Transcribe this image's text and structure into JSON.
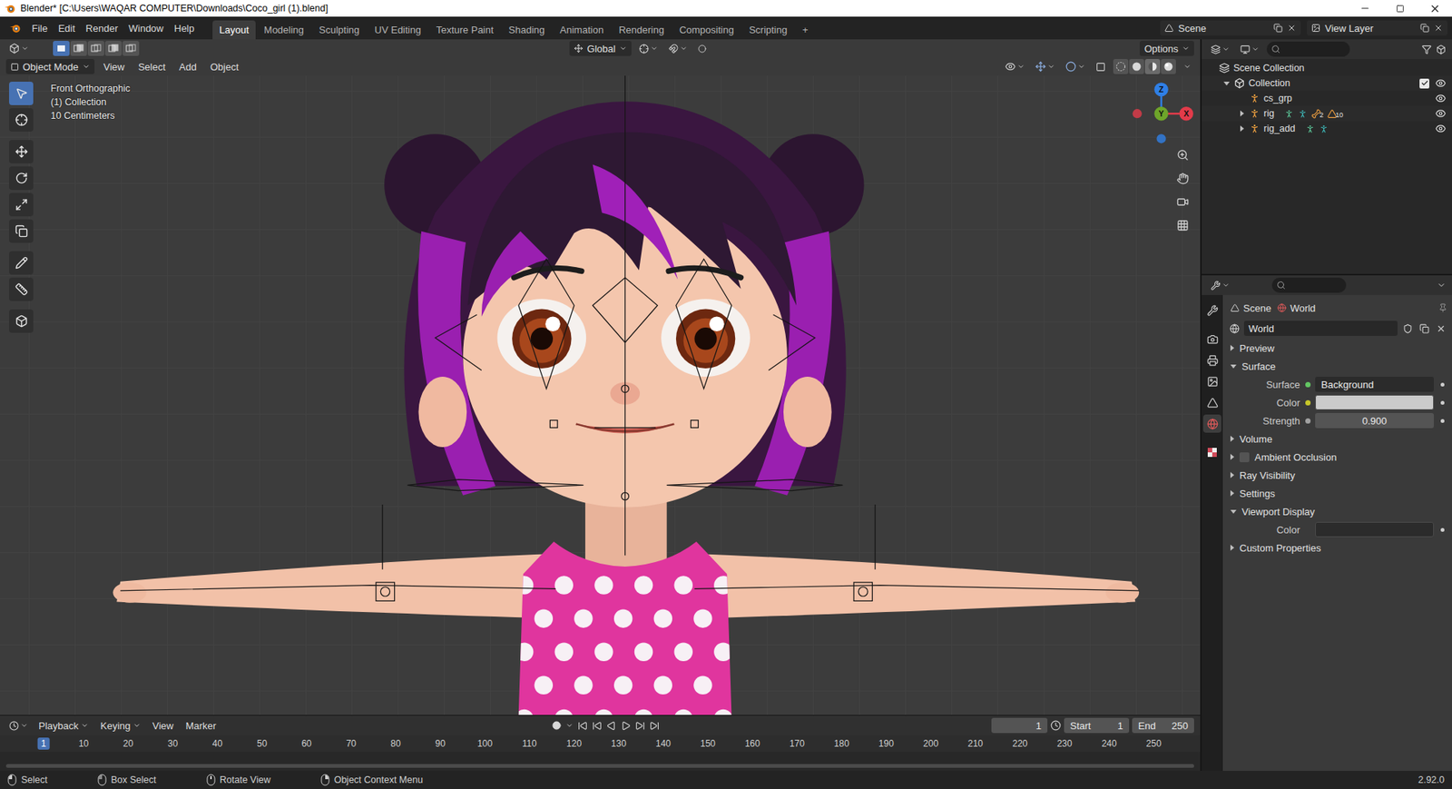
{
  "window": {
    "title": "Blender* [C:\\Users\\WAQAR COMPUTER\\Downloads\\Coco_girl (1).blend]"
  },
  "menus": [
    "File",
    "Edit",
    "Render",
    "Window",
    "Help"
  ],
  "workspaces": [
    {
      "label": "Layout",
      "selected": true
    },
    {
      "label": "Modeling",
      "selected": false
    },
    {
      "label": "Sculpting",
      "selected": false
    },
    {
      "label": "UV Editing",
      "selected": false
    },
    {
      "label": "Texture Paint",
      "selected": false
    },
    {
      "label": "Shading",
      "selected": false
    },
    {
      "label": "Animation",
      "selected": false
    },
    {
      "label": "Rendering",
      "selected": false
    },
    {
      "label": "Compositing",
      "selected": false
    },
    {
      "label": "Scripting",
      "selected": false
    }
  ],
  "add_workspace": "+",
  "scene": "Scene",
  "view_layer": "View Layer",
  "viewport": {
    "orientation": "Global",
    "options": "Options",
    "mode": "Object Mode",
    "menus": [
      "View",
      "Select",
      "Add",
      "Object"
    ],
    "info": [
      "Front Orthographic",
      "(1) Collection",
      "10 Centimeters"
    ],
    "select_modes": [
      {
        "selected": true
      },
      {
        "selected": false
      },
      {
        "selected": false
      },
      {
        "selected": false
      },
      {
        "selected": false
      }
    ],
    "tools": [
      {
        "selected": true
      },
      {
        "selected": false
      },
      {
        "selected": false
      },
      {
        "selected": false
      },
      {
        "selected": false
      },
      {
        "selected": false
      },
      {
        "selected": false
      },
      {
        "selected": false
      },
      {
        "selected": false
      }
    ],
    "gizmo": [
      {
        "label": "Z",
        "color": "#2f7fe6"
      },
      {
        "label": "Y",
        "color": "#6ea52a"
      },
      {
        "label": "X",
        "color": "#e23b4a"
      }
    ],
    "shading": [
      {
        "selected": false
      },
      {
        "selected": false
      },
      {
        "selected": true
      },
      {
        "selected": false
      }
    ]
  },
  "outliner": {
    "items": [
      {
        "label": "Scene Collection",
        "depth": 0,
        "kind": "scene_collection"
      },
      {
        "label": "Collection",
        "depth": 1,
        "kind": "collection",
        "expanded": true,
        "checked": true,
        "visible": true
      },
      {
        "label": "cs_grp",
        "depth": 2,
        "kind": "armature",
        "visible": true
      },
      {
        "label": "rig",
        "depth": 2,
        "kind": "armature",
        "expanded": false,
        "visible": true,
        "sub_icons": [
          {
            "kind": "armature_data"
          },
          {
            "kind": "pose"
          },
          {
            "kind": "bone",
            "count": "2"
          },
          {
            "kind": "mesh",
            "count": "10"
          }
        ]
      },
      {
        "label": "rig_add",
        "depth": 2,
        "kind": "armature",
        "expanded": false,
        "visible": true,
        "sub_icons": [
          {
            "kind": "armature_data"
          },
          {
            "kind": "pose"
          }
        ]
      }
    ]
  },
  "properties": {
    "tabs": [
      {
        "selected": false
      },
      {
        "selected": false
      },
      {
        "selected": false
      },
      {
        "selected": false
      },
      {
        "selected": false
      },
      {
        "selected": true
      },
      {
        "selected": false
      }
    ],
    "breadcrumb": [
      "Scene",
      "World"
    ],
    "datablock": "World",
    "panels": [
      {
        "label": "Preview",
        "expanded": false
      },
      {
        "label": "Surface",
        "expanded": true,
        "rows": [
          {
            "label": "Surface",
            "kind": "link",
            "color": "#63c763",
            "value": "Background"
          },
          {
            "label": "Color",
            "kind": "swatch",
            "color": "#c7c729",
            "swatch": "#cbcbcb"
          },
          {
            "label": "Strength",
            "kind": "number",
            "color": "#a1a1a1",
            "value": "0.900"
          }
        ]
      },
      {
        "label": "Volume",
        "expanded": false
      },
      {
        "label": "Ambient Occlusion",
        "expanded": false,
        "checked": false
      },
      {
        "label": "Ray Visibility",
        "expanded": false
      },
      {
        "label": "Settings",
        "expanded": false
      },
      {
        "label": "Viewport Display",
        "expanded": true,
        "rows": [
          {
            "label": "Color",
            "kind": "swatch",
            "swatch": "#2b2b2b"
          }
        ]
      },
      {
        "label": "Custom Properties",
        "expanded": false
      }
    ]
  },
  "timeline": {
    "menus": [
      "Playback",
      "Keying",
      "View",
      "Marker"
    ],
    "current_frame": "1",
    "start_label": "Start",
    "start": "1",
    "end_label": "End",
    "end": "250",
    "ruler": [
      "1",
      "10",
      "20",
      "30",
      "40",
      "50",
      "60",
      "70",
      "80",
      "90",
      "100",
      "110",
      "120",
      "130",
      "140",
      "150",
      "160",
      "170",
      "180",
      "190",
      "200",
      "210",
      "220",
      "230",
      "240",
      "250"
    ]
  },
  "status": {
    "items": [
      {
        "label": "Select",
        "kind": "lmb"
      },
      {
        "label": "Box Select",
        "kind": "drag"
      },
      {
        "label": "Rotate View",
        "kind": "mmb"
      },
      {
        "label": "Object Context Menu",
        "kind": "rmb"
      }
    ],
    "version": "2.92.0"
  }
}
